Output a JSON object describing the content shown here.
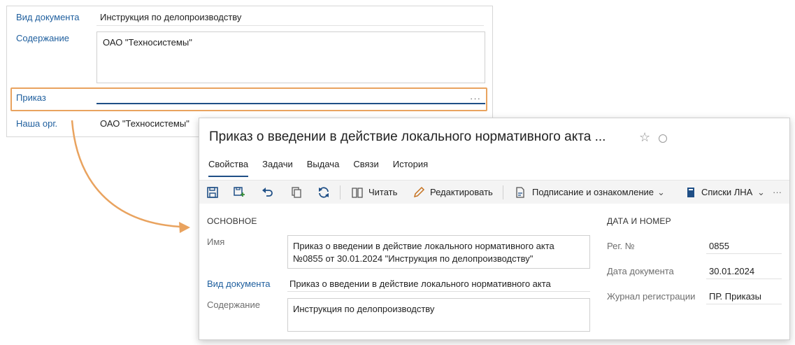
{
  "background_form": {
    "doc_type_label": "Вид документа",
    "doc_type_value": "Инструкция по делопроизводству",
    "content_label": "Содержание",
    "content_value": "ОАО \"Техносистемы\"",
    "order_label": "Приказ",
    "order_dots": "···",
    "org_label": "Наша орг.",
    "org_value": "ОАО \"Техносистемы\""
  },
  "dialog": {
    "title": "Приказ о введении в действие локального нормативного акта ...",
    "tabs": [
      "Свойства",
      "Задачи",
      "Выдача",
      "Связи",
      "История"
    ],
    "active_tab": "Свойства",
    "toolbar": {
      "read_label": "Читать",
      "edit_label": "Редактировать",
      "sign_label": "Подписание и ознакомление",
      "lna_label": "Списки ЛНА",
      "more": "···"
    },
    "main_section": {
      "title": "ОСНОВНОЕ",
      "name_label": "Имя",
      "name_value": "Приказ о введении в действие локального нормативного акта №0855 от 30.01.2024 \"Инструкция по делопроизводству\"",
      "doc_type_label": "Вид документа",
      "doc_type_value": "Приказ о введении в действие локального нормативного акта",
      "content_label": "Содержание",
      "content_value": "Инструкция по делопроизводству"
    },
    "date_section": {
      "title": "ДАТА И НОМЕР",
      "reg_label": "Рег. №",
      "reg_value": "0855",
      "date_label": "Дата документа",
      "date_value": "30.01.2024",
      "journal_label": "Журнал регистрации",
      "journal_value": "ПР. Приказы"
    }
  },
  "colors": {
    "accent": "#1f4f86",
    "link": "#1f5f9e",
    "highlight": "#e9a35f"
  }
}
